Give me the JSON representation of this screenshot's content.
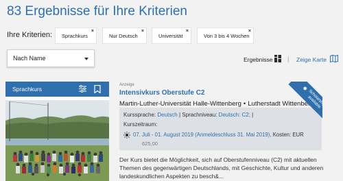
{
  "header": {
    "title": "83 Ergebnisse für Ihre Kriterien"
  },
  "criteria": {
    "label": "Ihre Kriterien:",
    "chips": [
      "Sprachkurs",
      "Nur Deutsch",
      "Universität",
      "Von 3 bis 4 Wochen"
    ],
    "remove_glyph": "×"
  },
  "sort": {
    "selected": "Nach Name"
  },
  "view": {
    "results_label": "Ergebnisse",
    "separator": "|",
    "map_link": "Zeige Karte"
  },
  "card": {
    "category": "Sprachkurs"
  },
  "result": {
    "ad_label": "Anzeige",
    "title": "Intensivkurs Oberstufe C2",
    "school": "Martin-Luther-Universität Halle-Wittenberg",
    "bullet": "•",
    "city": "Lutherstadt Wittenberg",
    "language_label": "Kurssprache:",
    "language_value": "Deutsch",
    "level_label": "Sprachniveau:",
    "level_value": "Deutsch: C2;",
    "period_label": "Kurszeitraum:",
    "date_text": "07. Juli - 01. August 2019 (Anmeldeschluss 31. Mai 2019),",
    "cost_label": "Kosten: EUR",
    "cost_value": "625,00",
    "ribbon_line1": "Scholarships",
    "ribbon_line2": "available",
    "description": "Der Kurs bietet die Möglichkeit, sich auf Oberstufenniveau (C2) mit aktuellen Themen des gegenwärtigen Deutschlands, mit Geschichte, Kultur und anderen landeskundlichen Aspekten zu besch&..."
  },
  "colors": {
    "accent": "#2f6fae",
    "background": "#f2f2f2",
    "info_box": "#dde1e6"
  },
  "icons": [
    "grid-view-icon",
    "map-icon",
    "filter-icon",
    "bookmark-icon",
    "sun-icon",
    "star-icon",
    "chevron-down-icon",
    "close-icon"
  ]
}
